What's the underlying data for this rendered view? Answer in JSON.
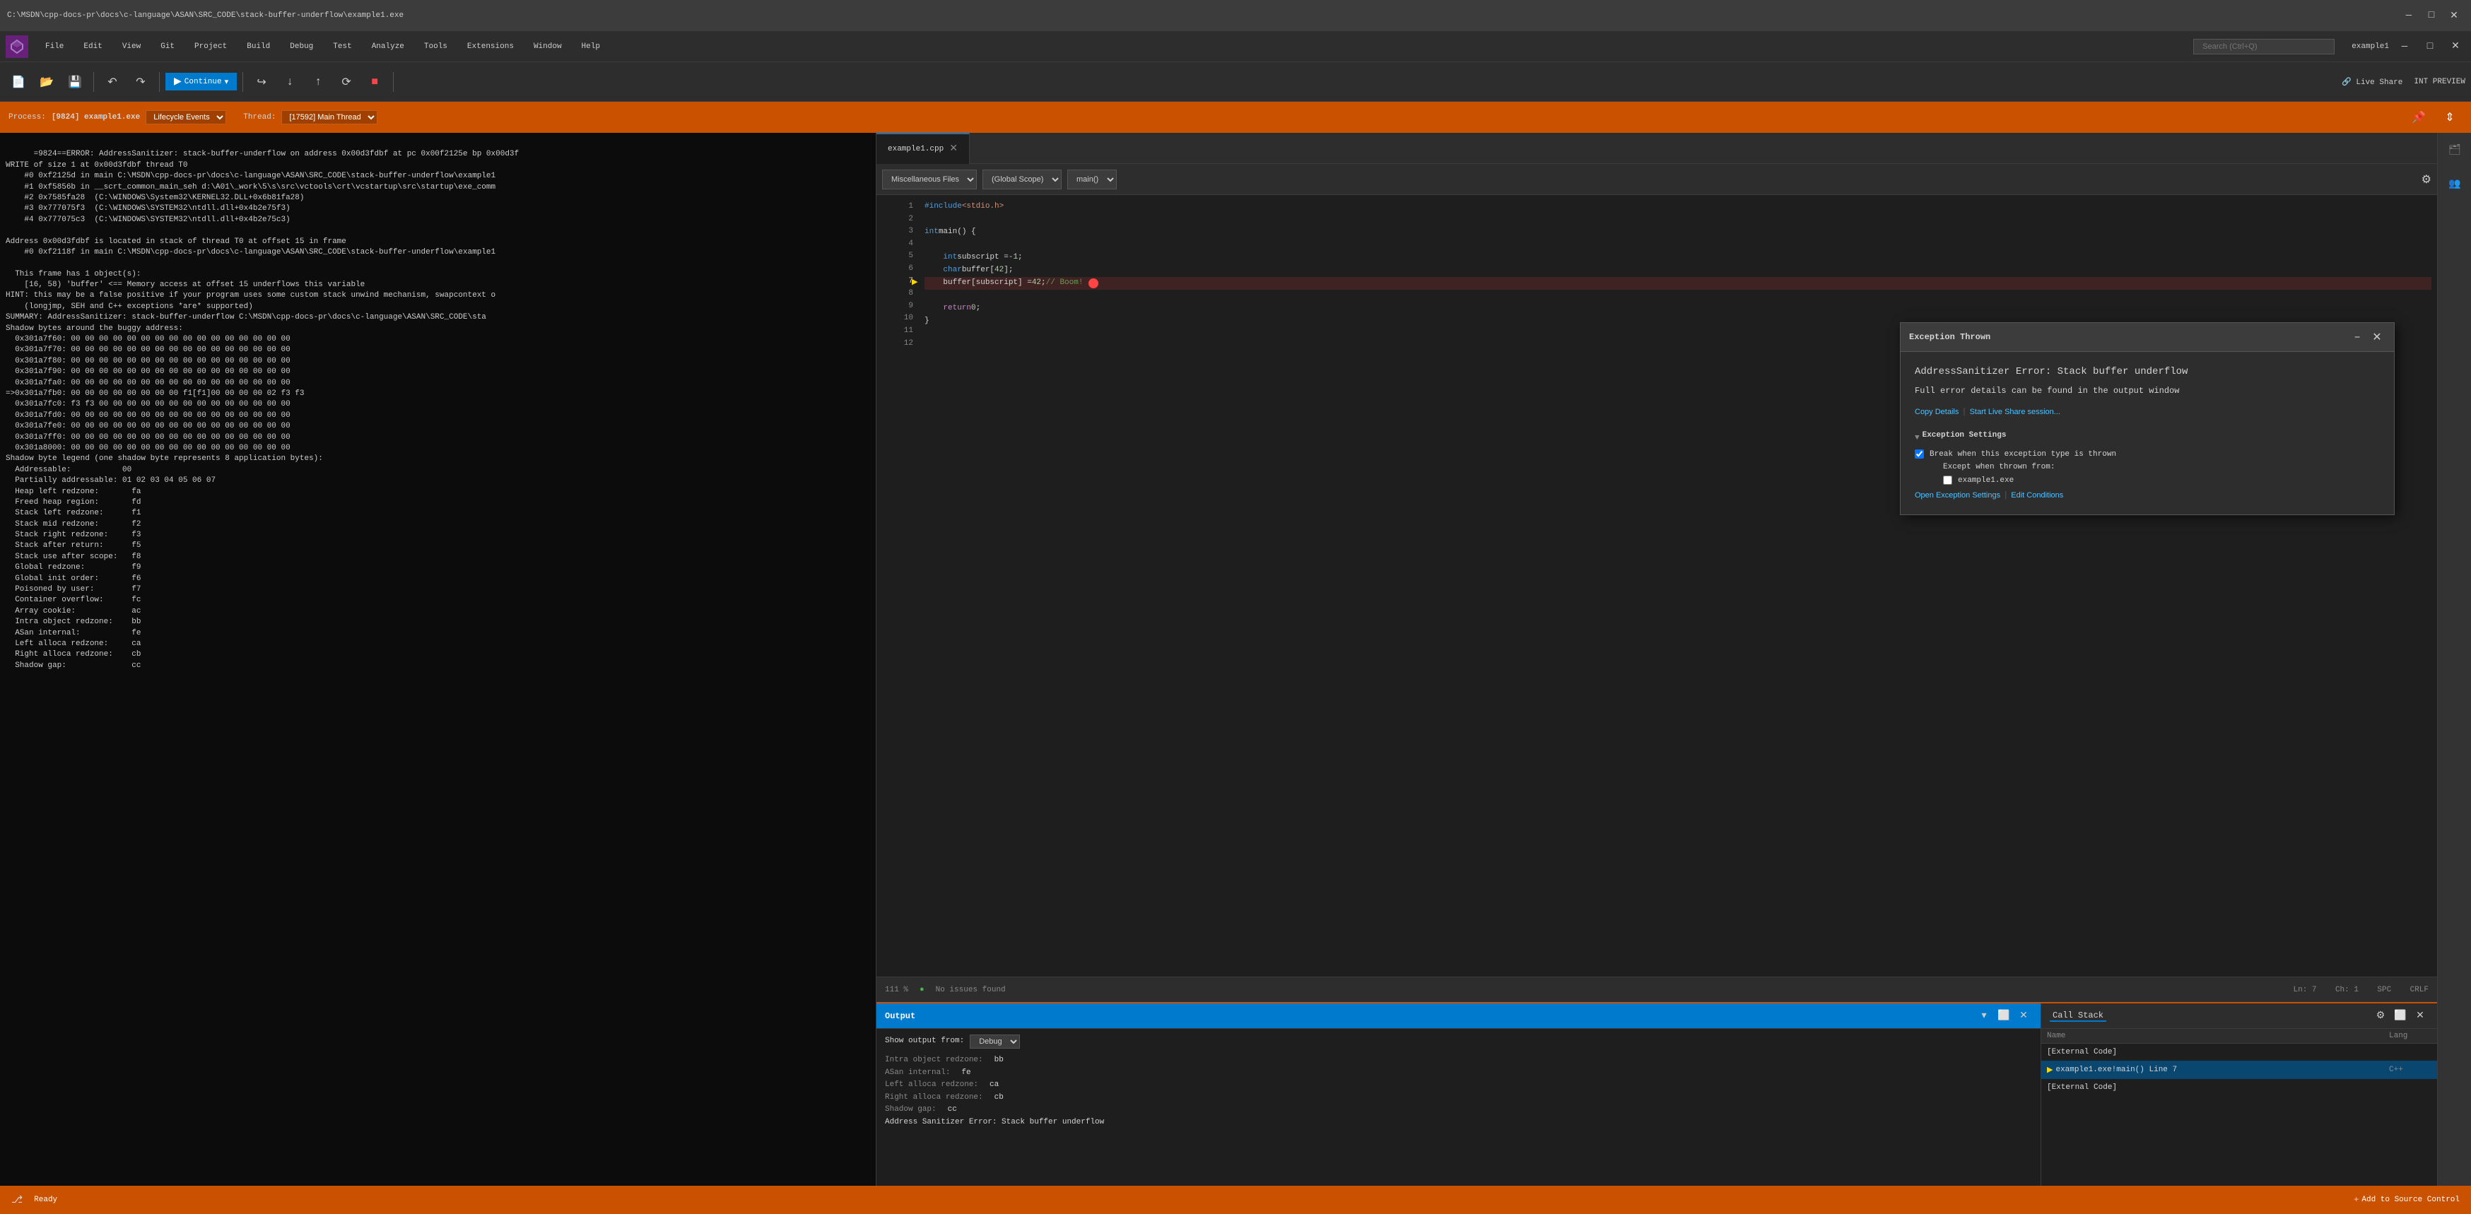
{
  "titlebar": {
    "text": "C:\\MSDN\\cpp-docs-pr\\docs\\c-language\\ASAN\\SRC_CODE\\stack-buffer-underflow\\example1.exe"
  },
  "menubar": {
    "items": [
      "File",
      "Edit",
      "View",
      "Git",
      "Project",
      "Build",
      "Debug",
      "Test",
      "Analyze",
      "Tools",
      "Extensions",
      "Window",
      "Help"
    ],
    "search_placeholder": "Search (Ctrl+Q)",
    "window_title": "example1"
  },
  "process_bar": {
    "process_label": "Process:",
    "process_value": "[9824] example1.exe",
    "lifecycle_label": "Lifecycle Events",
    "thread_label": "Thread:",
    "thread_value": "[17592] Main Thread"
  },
  "editor": {
    "tab_name": "example1.cpp",
    "file_path": "Miscellaneous Files",
    "scope": "(Global Scope)",
    "function": "main()",
    "lines": [
      {
        "num": 1,
        "content": "#include <stdio.h>",
        "tokens": [
          {
            "type": "include",
            "text": "#include <stdio.h>"
          }
        ]
      },
      {
        "num": 2,
        "content": ""
      },
      {
        "num": 3,
        "content": "int main() {",
        "tokens": [
          {
            "type": "kw",
            "text": "int"
          },
          {
            "type": "plain",
            "text": " main() {"
          }
        ]
      },
      {
        "num": 4,
        "content": ""
      },
      {
        "num": 5,
        "content": "    int subscript = -1;",
        "tokens": []
      },
      {
        "num": 6,
        "content": "    char buffer[42];",
        "tokens": []
      },
      {
        "num": 7,
        "content": "    buffer[subscript] = 42; // Boom!",
        "tokens": [],
        "highlighted": true,
        "has_error": true
      },
      {
        "num": 8,
        "content": ""
      },
      {
        "num": 9,
        "content": "    return 0;",
        "tokens": []
      },
      {
        "num": 10,
        "content": "}"
      },
      {
        "num": 11,
        "content": ""
      },
      {
        "num": 12,
        "content": ""
      }
    ]
  },
  "exception_popup": {
    "title": "Exception Thrown",
    "main_title": "AddressSanitizer Error: Stack buffer underflow",
    "subtitle": "Full error details can be found in the output window",
    "link_copy": "Copy Details",
    "link_live_share": "Start Live Share session...",
    "section_title": "Exception Settings",
    "checkbox_label": "Break when this exception type is thrown",
    "except_when_label": "Except when thrown from:",
    "example1_checkbox": "example1.exe",
    "bottom_link1": "Open Exception Settings",
    "bottom_link2": "Edit Conditions"
  },
  "terminal": {
    "content": "=9824==ERROR: AddressSanitizer: stack-buffer-underflow on address 0x00d3fdbf at pc 0x00f2125e bp 0x00d3f\nWRITE of size 1 at 0x00d3fdbf thread T0\n    #0 0xf2125d in main C:\\MSDN\\cpp-docs-pr\\docs\\c-language\\ASAN\\SRC_CODE\\stack-buffer-underflow\\example1\n    #1 0xf5856b in __scrt_common_main_seh d:\\A01\\_work\\5\\s\\src\\vctools\\crt\\vcstartup\\src\\startup\\exe_comm\n    #2 0x7585fa28  (C:\\WINDOWS\\System32\\KERNEL32.DLL+0x6b81fa28)\n    #3 0x777075f3  (C:\\WINDOWS\\SYSTEM32\\ntdll.dll+0x4b2e75f3)\n    #4 0x777075c3  (C:\\WINDOWS\\SYSTEM32\\ntdll.dll+0x4b2e75c3)\n\nAddress 0x00d3fdbf is located in stack of thread T0 at offset 15 in frame\n    #0 0xf2118f in main C:\\MSDN\\cpp-docs-pr\\docs\\c-language\\ASAN\\SRC_CODE\\stack-buffer-underflow\\example1\n\n  This frame has 1 object(s):\n    [16, 58) 'buffer' <== Memory access at offset 15 underflows this variable\nHINT: this may be a false positive if your program uses some custom stack unwind mechanism, swapcontext o\n    (longjmp, SEH and C++ exceptions *are* supported)\nSUMMARY: AddressSanitizer: stack-buffer-underflow C:\\MSDN\\cpp-docs-pr\\docs\\c-language\\ASAN\\SRC_CODE\\sta\nShadow bytes around the buggy address:\n  0x301a7f60: 00 00 00 00 00 00 00 00 00 00 00 00 00 00 00 00\n  0x301a7f70: 00 00 00 00 00 00 00 00 00 00 00 00 00 00 00 00\n  0x301a7f80: 00 00 00 00 00 00 00 00 00 00 00 00 00 00 00 00\n  0x301a7f90: 00 00 00 00 00 00 00 00 00 00 00 00 00 00 00 00\n  0x301a7fa0: 00 00 00 00 00 00 00 00 00 00 00 00 00 00 00 00\n=>0x301a7fb0: 00 00 00 00 00 00 00 00 f1[f1]00 00 00 00 02 f3 f3\n  0x301a7fc0: f3 f3 00 00 00 00 00 00 00 00 00 00 00 00 00 00\n  0x301a7fd0: 00 00 00 00 00 00 00 00 00 00 00 00 00 00 00 00\n  0x301a7fe0: 00 00 00 00 00 00 00 00 00 00 00 00 00 00 00 00\n  0x301a7ff0: 00 00 00 00 00 00 00 00 00 00 00 00 00 00 00 00\n  0x301a8000: 00 00 00 00 00 00 00 00 00 00 00 00 00 00 00 00\nShadow byte legend (one shadow byte represents 8 application bytes):\n  Addressable:           00\n  Partially addressable: 01 02 03 04 05 06 07\n  Heap left redzone:       fa\n  Freed heap region:       fd\n  Stack left redzone:      f1\n  Stack mid redzone:       f2\n  Stack right redzone:     f3\n  Stack after return:      f5\n  Stack use after scope:   f8\n  Global redzone:          f9\n  Global init order:       f6\n  Poisoned by user:        f7\n  Container overflow:      fc\n  Array cookie:            ac\n  Intra object redzone:    bb\n  ASan internal:           fe\n  Left alloca redzone:     ca\n  Right alloca redzone:    cb\n  Shadow gap:              cc"
  },
  "output_panel": {
    "title": "Output",
    "show_output_label": "Show output from:",
    "show_output_value": "Debug",
    "content_lines": [
      {
        "label": "Intra object redzone:",
        "value": "bb"
      },
      {
        "label": "ASan internal:",
        "value": "fe"
      },
      {
        "label": "Left alloca redzone:",
        "value": "ca"
      },
      {
        "label": "Right alloca redzone:",
        "value": "cb"
      },
      {
        "label": "Shadow gap:",
        "value": "cc"
      },
      {
        "label": "Address Sanitizer Error: Stack buffer underflow",
        "value": ""
      }
    ]
  },
  "callstack_panel": {
    "title": "Call Stack",
    "columns": [
      "Name",
      "Lang"
    ],
    "rows": [
      {
        "name": "[External Code]",
        "lang": "",
        "active": false,
        "arrow": false
      },
      {
        "name": "example1.exe!main() Line 7",
        "lang": "C++",
        "active": true,
        "arrow": true
      },
      {
        "name": "[External Code]",
        "lang": "",
        "active": false,
        "arrow": false
      }
    ]
  },
  "status_bar": {
    "ready_label": "Ready",
    "issues_label": "No issues found",
    "add_source_control": "Add to Source Control",
    "ln": "Ln: 7",
    "ch": "Ch: 1",
    "spc": "SPC",
    "crlf": "CRLF"
  },
  "zoom": {
    "level": "111 %"
  },
  "colors": {
    "accent_orange": "#ca5100",
    "accent_blue": "#007acc",
    "vs_purple": "#68217a"
  }
}
